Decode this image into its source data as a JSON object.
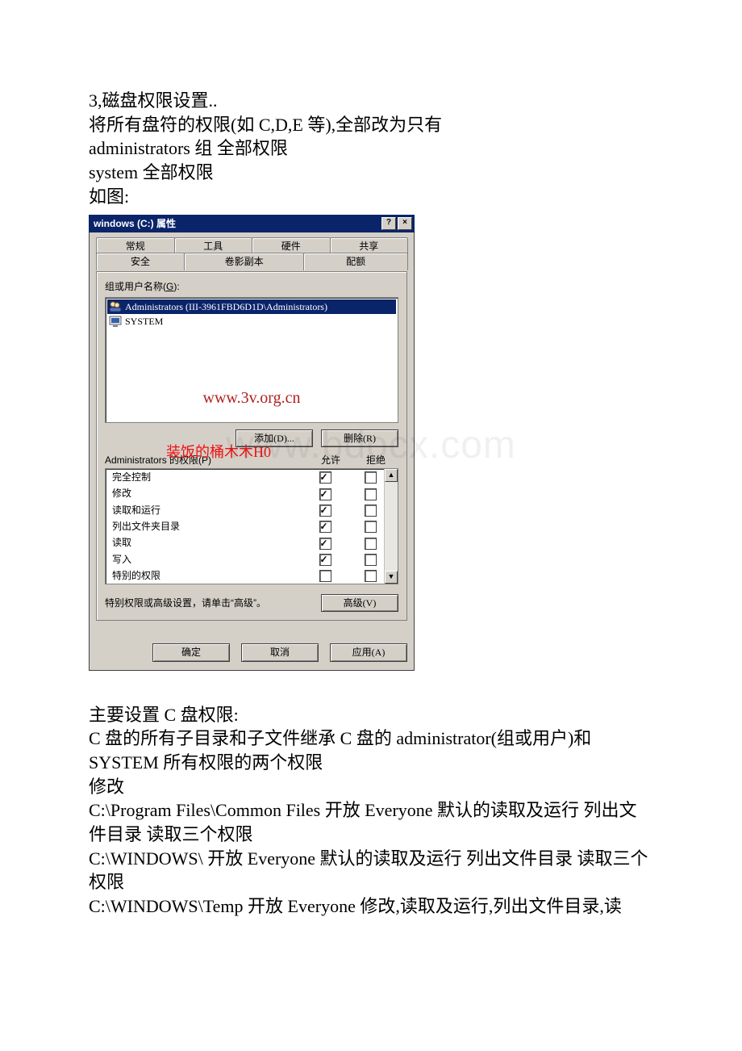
{
  "doc": {
    "p1": "3,磁盘权限设置..",
    "p2": "将所有盘符的权限(如 C,D,E 等),全部改为只有",
    "p3": "administrators 组 全部权限",
    "p4": "system 全部权限",
    "p5": "如图:",
    "p6": "主要设置 C 盘权限:",
    "p7": "C 盘的所有子目录和子文件继承 C 盘的 administrator(组或用户)和SYSTEM 所有权限的两个权限",
    "p8": "修改",
    "p9": "C:\\Program Files\\Common Files 开放 Everyone    默认的读取及运行 列出文件目录 读取三个权限",
    "p10": "C:\\WINDOWS\\ 开放 Everyone    默认的读取及运行 列出文件目录 读取三个权限",
    "p11": "C:\\WINDOWS\\Temp 开放 Everyone 修改,读取及运行,列出文件目录,读"
  },
  "dialog": {
    "title": "windows (C:) 属性",
    "help": "?",
    "close": "×",
    "tabs_back": [
      "常规",
      "工具",
      "硬件",
      "共享"
    ],
    "tabs_front": [
      "安全",
      "卷影副本",
      "配额"
    ],
    "groupUsers": {
      "label": "组或用户名称(",
      "u": "G",
      "after": "):"
    },
    "users": [
      {
        "text": "Administrators (III-3961FBD6D1D\\Administrators)",
        "sel": true
      },
      {
        "text": "SYSTEM",
        "sel": false
      }
    ],
    "wm3v": "www.3v.org.cn",
    "btnAdd": "添加(D)...",
    "btnRemove": "删除(R)",
    "permFor": "Administrators 的权限(P)",
    "colAllow": "允许",
    "colDeny": "拒绝",
    "redOverlay": "装饭的桶木木H0",
    "perms": [
      {
        "name": "完全控制",
        "allow": true,
        "deny": false
      },
      {
        "name": "修改",
        "allow": true,
        "deny": false
      },
      {
        "name": "读取和运行",
        "allow": true,
        "deny": false
      },
      {
        "name": "列出文件夹目录",
        "allow": true,
        "deny": false
      },
      {
        "name": "读取",
        "allow": true,
        "deny": false
      },
      {
        "name": "写入",
        "allow": true,
        "deny": false
      },
      {
        "name": "特别的权限",
        "allow": false,
        "deny": false
      }
    ],
    "advText": "特别权限或高级设置，请单击“高级”。",
    "btnAdv": "高级(V)",
    "btnOK": "确定",
    "btnCancel": "取消",
    "btnApply": "应用(A)"
  },
  "watermark_grey": "www.bdocx.com"
}
